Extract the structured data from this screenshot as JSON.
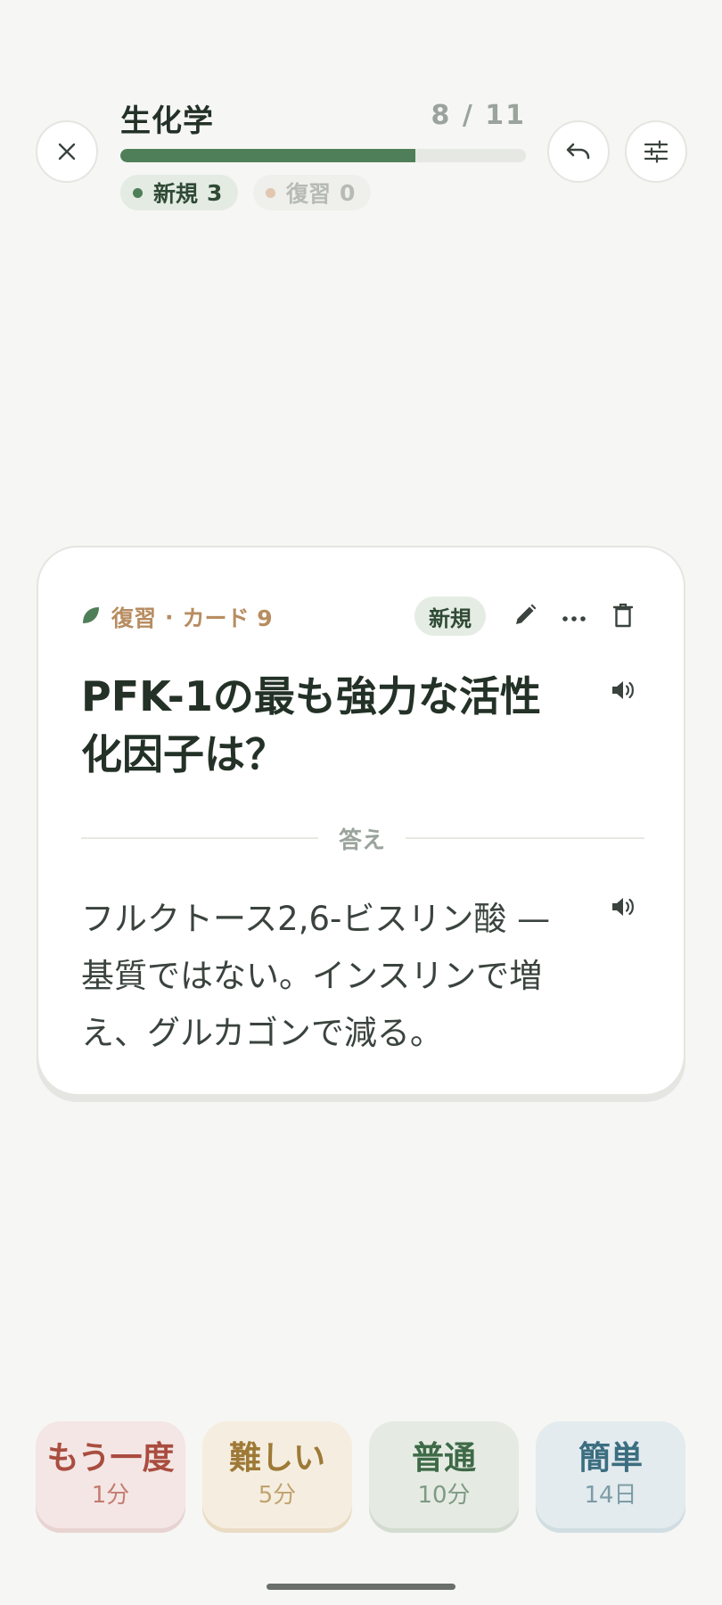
{
  "header": {
    "deck_title": "生化学",
    "progress_text": "8 / 11",
    "progress_fraction": 0.727,
    "new_label": "新規",
    "new_count": "3",
    "review_label": "復習",
    "review_count": "0",
    "icons": {
      "close": "close-icon",
      "undo": "undo-icon",
      "settings": "sliders-icon"
    }
  },
  "card": {
    "meta_type": "復習",
    "meta_separator": "·",
    "meta_card": "カード 9",
    "badge": "新規",
    "question": "PFK-1の最も強力な活性化因子は？",
    "divider_label": "答え",
    "answer": "フルクトース2,6-ビスリン酸 — 基質ではない。インスリンで増え、グルカゴンで減る。"
  },
  "ratings": [
    {
      "label": "もう一度",
      "interval": "1分"
    },
    {
      "label": "難しい",
      "interval": "5分"
    },
    {
      "label": "普通",
      "interval": "10分"
    },
    {
      "label": "簡単",
      "interval": "14日"
    }
  ],
  "colors": {
    "accent_green": "#4f7f58",
    "meta_brown": "#b78d61",
    "again": "#a94d3f",
    "hard": "#9e7a37",
    "good": "#3e6a47",
    "easy": "#3b6e80"
  }
}
